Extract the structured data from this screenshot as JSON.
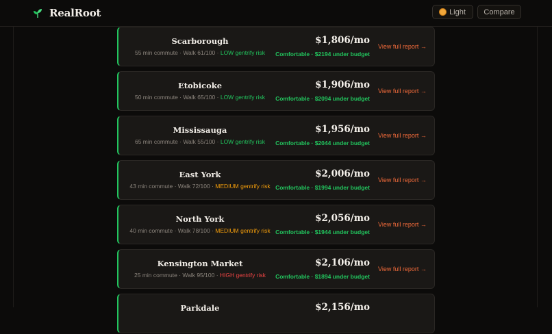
{
  "header": {
    "brand_name": "RealRoot",
    "theme_button": "Light",
    "compare_button": "Compare"
  },
  "colors": {
    "accent_green": "#22c55e",
    "risk_low": "#22c55e",
    "risk_medium": "#f59e0b",
    "risk_high": "#ef4444",
    "report_link": "#f06a3a"
  },
  "neighborhoods": [
    {
      "name": "Scarborough",
      "meta": "55 min commute · Walk 61/100 · ",
      "risk": "LOW gentrify risk",
      "risk_level": "low",
      "price": "$1,806/mo",
      "budget": "Comfortable · $2194 under budget",
      "link": "View full report →"
    },
    {
      "name": "Etobicoke",
      "meta": "50 min commute · Walk 65/100 · ",
      "risk": "LOW gentrify risk",
      "risk_level": "low",
      "price": "$1,906/mo",
      "budget": "Comfortable · $2094 under budget",
      "link": "View full report →"
    },
    {
      "name": "Mississauga",
      "meta": "65 min commute · Walk 55/100 · ",
      "risk": "LOW gentrify risk",
      "risk_level": "low",
      "price": "$1,956/mo",
      "budget": "Comfortable · $2044 under budget",
      "link": "View full report →"
    },
    {
      "name": "East York",
      "meta": "43 min commute · Walk 72/100 · ",
      "risk": "MEDIUM gentrify risk",
      "risk_level": "medium",
      "price": "$2,006/mo",
      "budget": "Comfortable · $1994 under budget",
      "link": "View full report →"
    },
    {
      "name": "North York",
      "meta": "40 min commute · Walk 78/100 · ",
      "risk": "MEDIUM gentrify risk",
      "risk_level": "medium",
      "price": "$2,056/mo",
      "budget": "Comfortable · $1944 under budget",
      "link": "View full report →"
    },
    {
      "name": "Kensington Market",
      "meta": "25 min commute · Walk 95/100 · ",
      "risk": "HIGH gentrify risk",
      "risk_level": "high",
      "price": "$2,106/mo",
      "budget": "Comfortable · $1894 under budget",
      "link": "View full report →"
    },
    {
      "name": "Parkdale",
      "meta": "",
      "risk": "",
      "risk_level": "low",
      "price": "$2,156/mo",
      "budget": "",
      "link": ""
    }
  ]
}
